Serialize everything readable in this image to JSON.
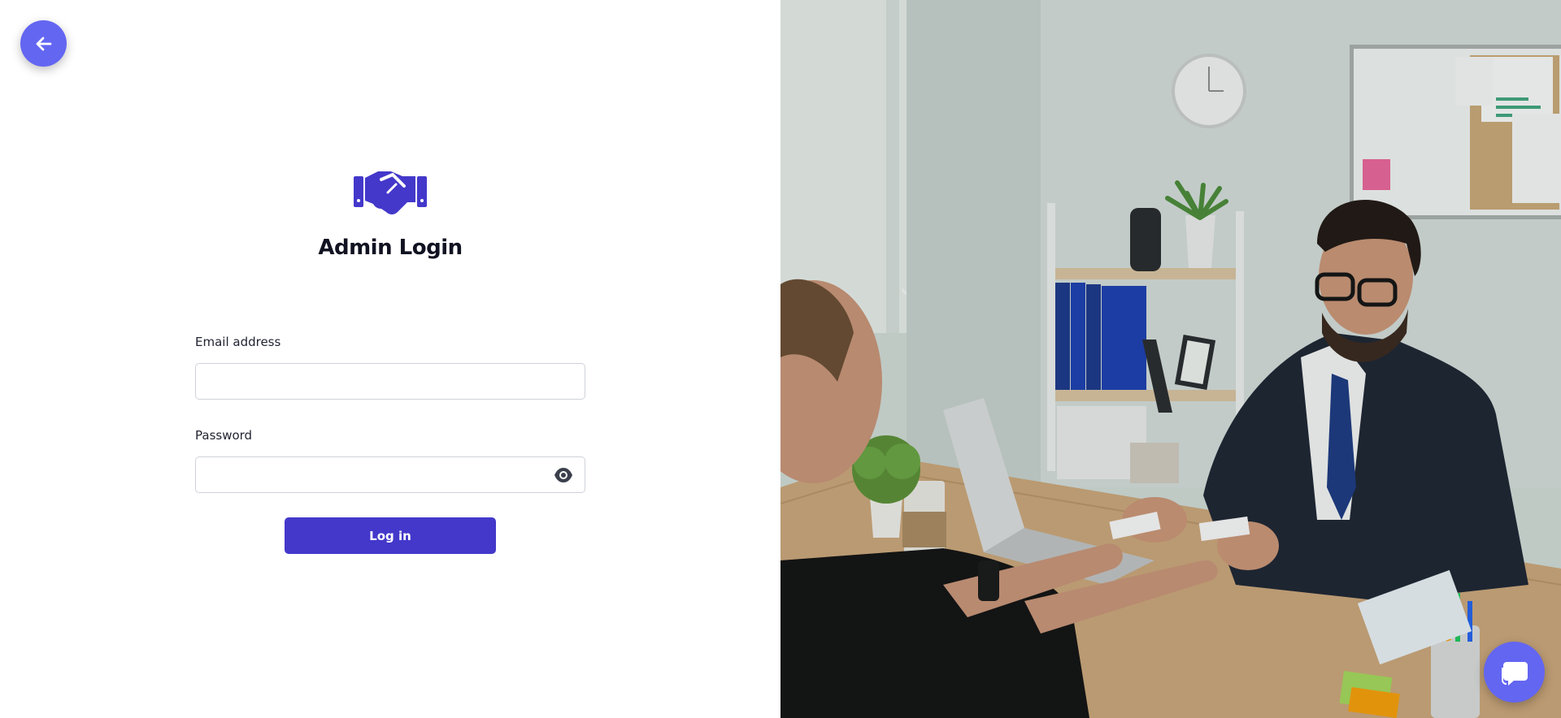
{
  "back_button": {
    "icon": "arrow-left-icon"
  },
  "header": {
    "title": "Admin Login",
    "logo_icon": "handshake-icon"
  },
  "form": {
    "email": {
      "label": "Email address",
      "value": "",
      "placeholder": ""
    },
    "password": {
      "label": "Password",
      "value": "",
      "placeholder": "",
      "toggle_icon": "eye-icon"
    },
    "submit_label": "Log in"
  },
  "hero_image": {
    "alt": "Two professionals exchanging business cards across an office desk"
  },
  "chat_button": {
    "icon": "chat-bubble-icon"
  },
  "colors": {
    "accent": "#4338ca",
    "accent_light": "#6366f1",
    "text": "#111322"
  }
}
